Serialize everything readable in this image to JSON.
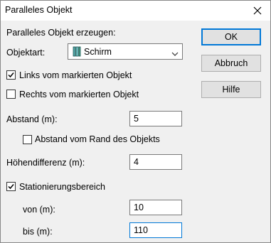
{
  "window": {
    "title": "Paralleles Objekt",
    "close_icon": "close-icon"
  },
  "form": {
    "heading": "Paralleles Objekt erzeugen:",
    "objektart_label": "Objektart:",
    "objektart_value": "Schirm",
    "objektart_icon": "screen-icon",
    "links_label": "Links vom markierten Objekt",
    "links_checked": true,
    "rechts_label": "Rechts vom markierten Objekt",
    "rechts_checked": false,
    "abstand_label": "Abstand (m):",
    "abstand_value": "5",
    "abstand_rand_label": "Abstand vom Rand des Objekts",
    "abstand_rand_checked": false,
    "hoehen_label": "Höhendifferenz (m):",
    "hoehen_value": "4",
    "station_label": "Stationierungsbereich",
    "station_checked": true,
    "von_label": "von (m):",
    "von_value": "10",
    "bis_label": "bis (m):",
    "bis_value": "110"
  },
  "buttons": {
    "ok": "OK",
    "abbruch": "Abbruch",
    "hilfe": "Hilfe"
  }
}
